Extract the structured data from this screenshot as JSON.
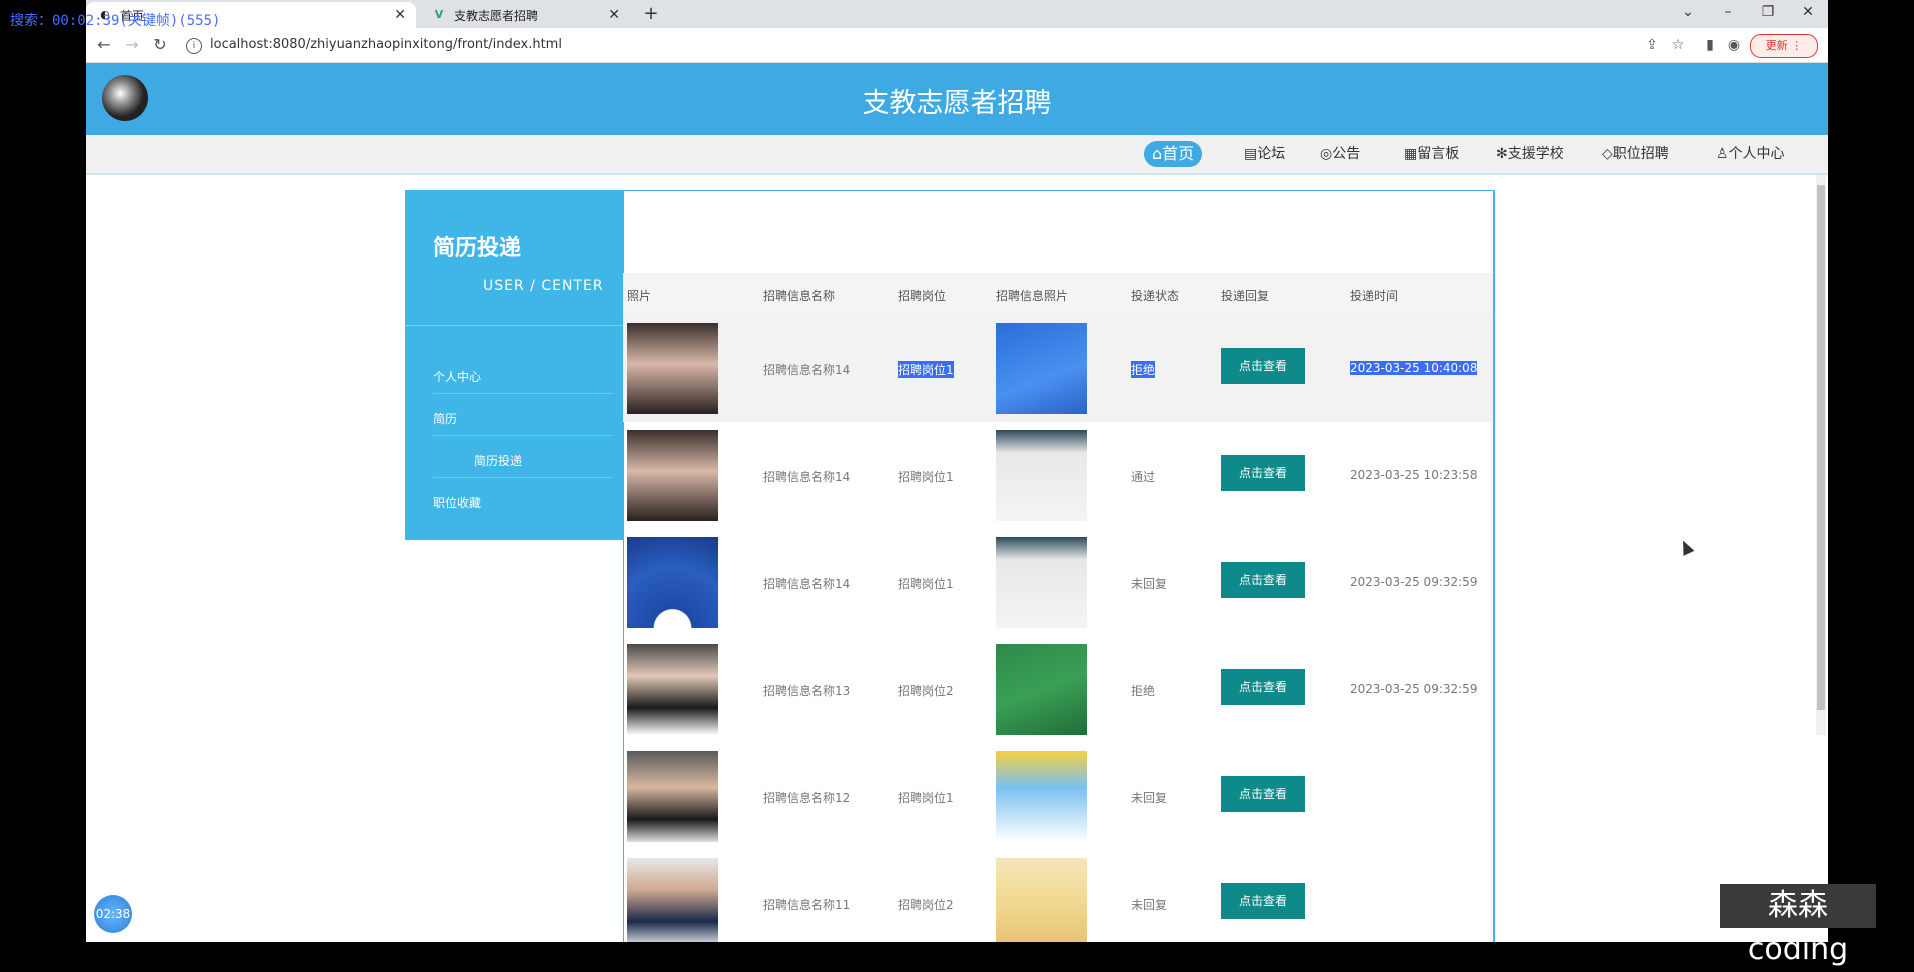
{
  "recording_overlay": "搜索：00:02:39(关键帧)(555)",
  "tabs": [
    {
      "title": "首页",
      "active": true
    },
    {
      "title": "支教志愿者招聘",
      "active": false
    }
  ],
  "address": {
    "url": "localhost:8080/zhiyuanzhaopinxitong/front/index.html",
    "update_label": "更新"
  },
  "site": {
    "title": "支教志愿者招聘"
  },
  "nav": [
    {
      "label": "首页",
      "icon": "home-icon",
      "active": true
    },
    {
      "label": "论坛",
      "icon": "forum-icon"
    },
    {
      "label": "公告",
      "icon": "notice-icon"
    },
    {
      "label": "留言板",
      "icon": "message-icon"
    },
    {
      "label": "支援学校",
      "icon": "school-icon"
    },
    {
      "label": "职位招聘",
      "icon": "tag-icon"
    },
    {
      "label": "个人中心",
      "icon": "user-icon"
    }
  ],
  "sidebar": {
    "title": "简历投递",
    "subtitle": "USER / CENTER",
    "items": [
      "个人中心",
      "简历",
      "简历投递",
      "职位收藏"
    ]
  },
  "table": {
    "headers": [
      "照片",
      "招聘信息名称",
      "招聘岗位",
      "招聘信息照片",
      "投递状态",
      "投递回复",
      "投递时间"
    ],
    "rows": [
      {
        "name": "招聘信息名称14",
        "position": "招聘岗位1",
        "status": "拒绝",
        "reply": "点击查看",
        "time": "2023-03-25 10:40:08"
      },
      {
        "name": "招聘信息名称14",
        "position": "招聘岗位1",
        "status": "通过",
        "reply": "点击查看",
        "time": "2023-03-25 10:23:58"
      },
      {
        "name": "招聘信息名称14",
        "position": "招聘岗位1",
        "status": "未回复",
        "reply": "点击查看",
        "time": "2023-03-25 09:32:59"
      },
      {
        "name": "招聘信息名称13",
        "position": "招聘岗位2",
        "status": "拒绝",
        "reply": "点击查看",
        "time": "2023-03-25 09:32:59"
      },
      {
        "name": "招聘信息名称12",
        "position": "招聘岗位1",
        "status": "未回复",
        "reply": "点击查看",
        "time": ""
      },
      {
        "name": "招聘信息名称11",
        "position": "招聘岗位2",
        "status": "未回复",
        "reply": "点击查看",
        "time": ""
      }
    ]
  },
  "timer": "02:38",
  "watermark": "森森coding",
  "colors": {
    "brand": "#3fa9e3",
    "sidebar": "#3fb5e8",
    "button": "#0e8a8a",
    "selection": "#3b6cf1"
  }
}
